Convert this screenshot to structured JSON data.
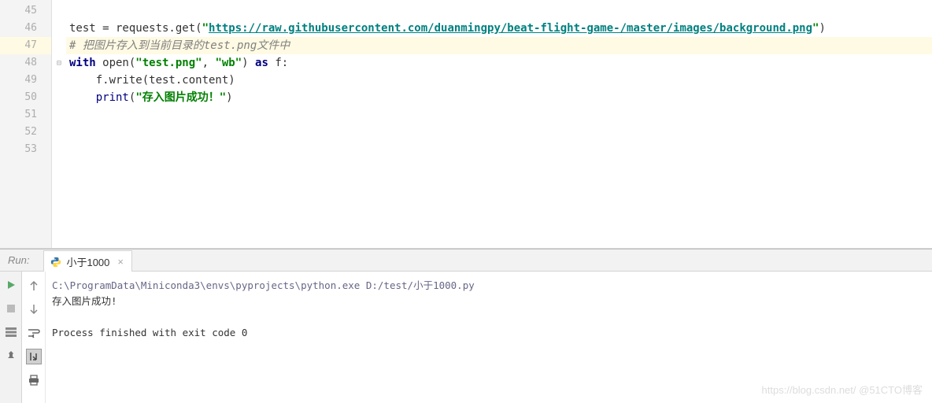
{
  "editor": {
    "lines": [
      {
        "num": "45",
        "tokens": []
      },
      {
        "num": "46",
        "tokens": [
          {
            "t": "test = requests.get(",
            "cls": ""
          },
          {
            "t": "\"",
            "cls": "str"
          },
          {
            "t": "https://raw.githubusercontent.com/duanmingpy/beat-flight-game-/master/images/background.png",
            "cls": "url"
          },
          {
            "t": "\"",
            "cls": "str"
          },
          {
            "t": ")",
            "cls": ""
          }
        ]
      },
      {
        "num": "47",
        "highlighted": true,
        "tokens": [
          {
            "t": "# 把图片存入到当前目录的test.png文件中",
            "cls": "comment"
          }
        ]
      },
      {
        "num": "48",
        "fold": "⊟",
        "tokens": [
          {
            "t": "with",
            "cls": "kw"
          },
          {
            "t": " open(",
            "cls": ""
          },
          {
            "t": "\"test.png\"",
            "cls": "str"
          },
          {
            "t": ", ",
            "cls": ""
          },
          {
            "t": "\"wb\"",
            "cls": "str"
          },
          {
            "t": ") ",
            "cls": ""
          },
          {
            "t": "as",
            "cls": "kw"
          },
          {
            "t": " f:",
            "cls": ""
          }
        ]
      },
      {
        "num": "49",
        "indent": "    ",
        "tokens": [
          {
            "t": "f.write(test.content)",
            "cls": ""
          }
        ]
      },
      {
        "num": "50",
        "indent": "    ",
        "foldend": true,
        "tokens": [
          {
            "t": "print",
            "cls": "builtin"
          },
          {
            "t": "(",
            "cls": ""
          },
          {
            "t": "\"存入图片成功！\"",
            "cls": "cn"
          },
          {
            "t": ")",
            "cls": ""
          }
        ]
      },
      {
        "num": "51",
        "tokens": []
      },
      {
        "num": "52",
        "tokens": []
      },
      {
        "num": "53",
        "tokens": []
      }
    ]
  },
  "run": {
    "label": "Run:",
    "tab_name": "小于1000",
    "console_path": "C:\\ProgramData\\Miniconda3\\envs\\pyprojects\\python.exe D:/test/小于1000.py",
    "console_output": "存入图片成功!",
    "console_exit": "Process finished with exit code 0"
  },
  "watermark": "https://blog.csdn.net/  @51CTO博客"
}
